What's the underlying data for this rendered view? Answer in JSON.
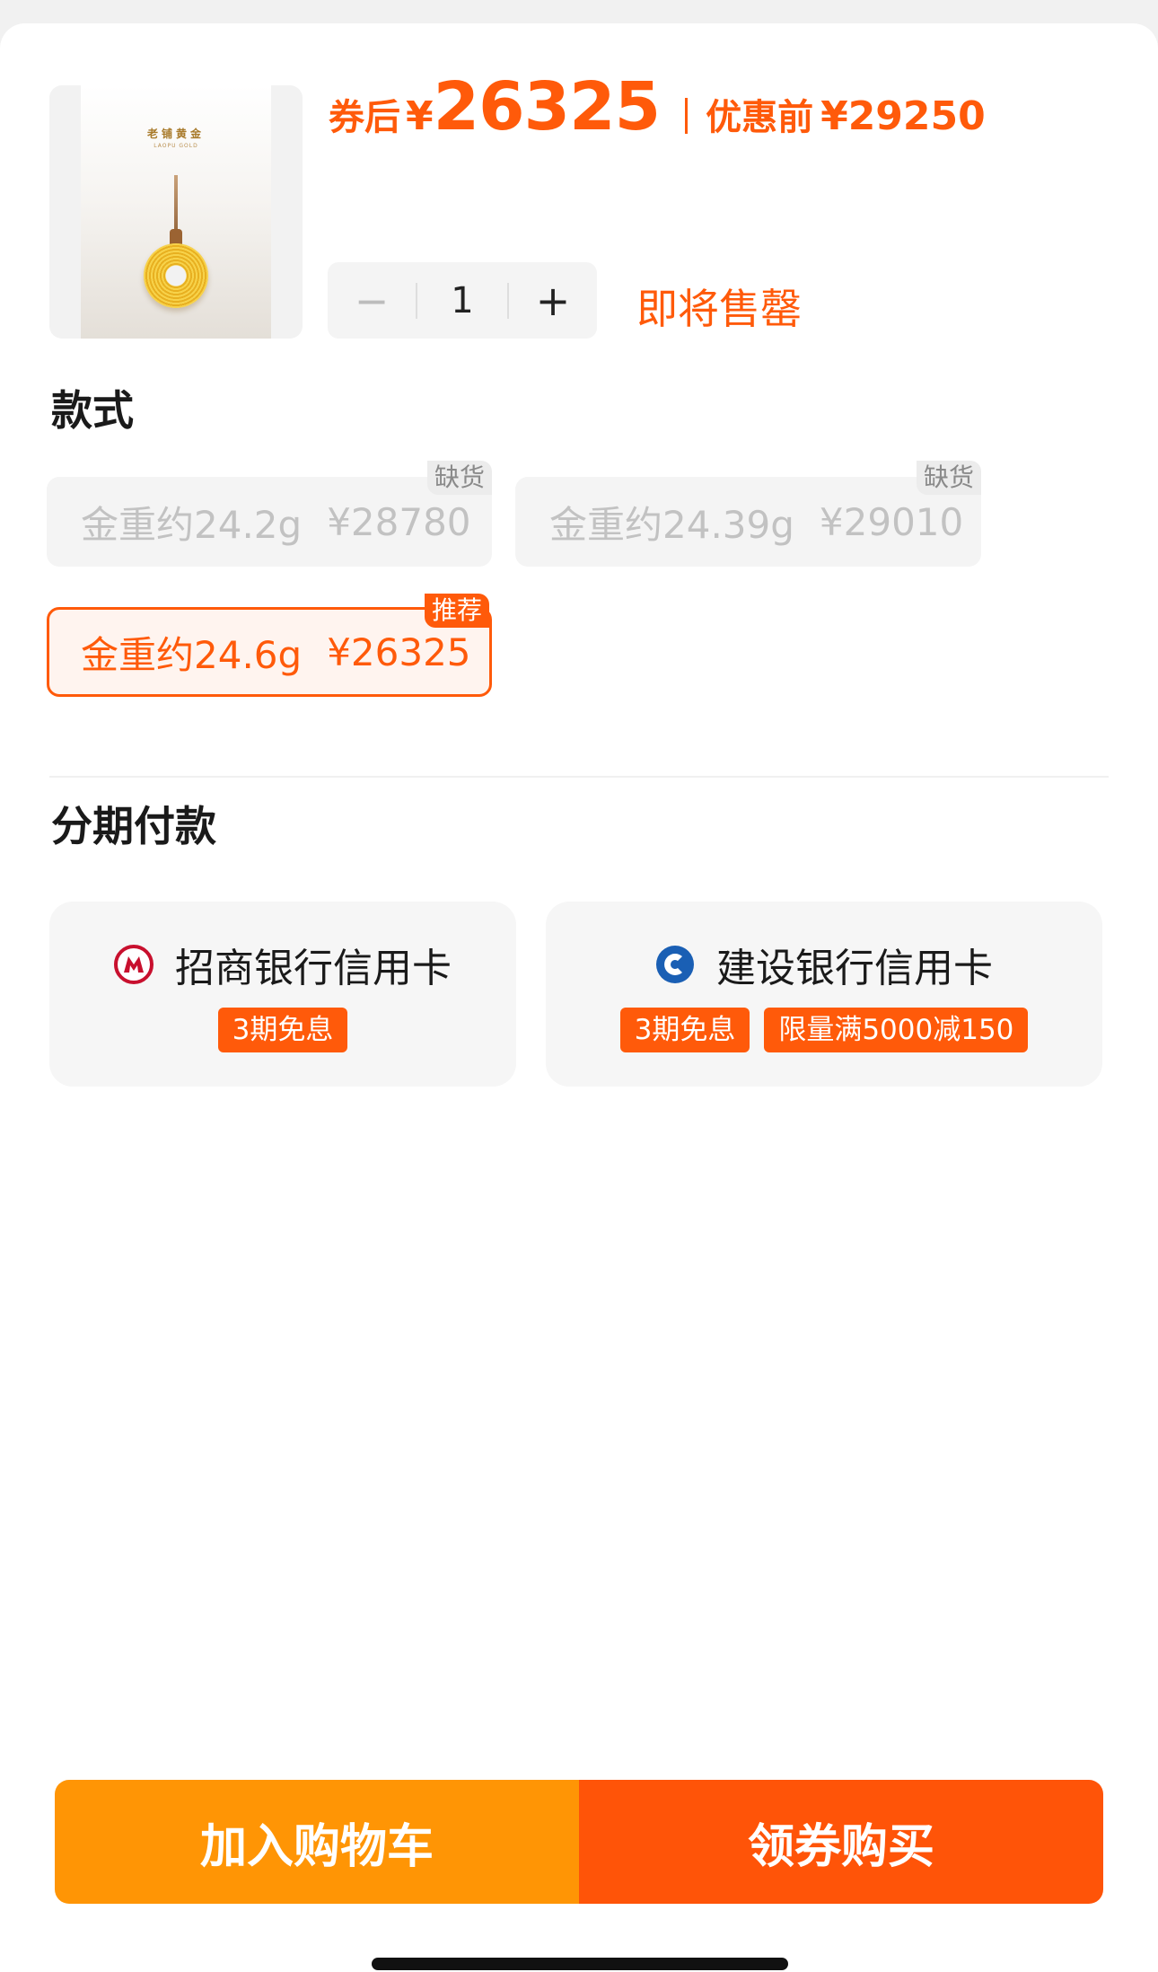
{
  "product": {
    "thumb_brand_cn": "老铺黄金",
    "thumb_brand_en": "LAOPU GOLD",
    "after_coupon_label": "券后",
    "currency": "¥",
    "after_coupon_price": "26325",
    "before_label": "优惠前",
    "before_price": "¥29250"
  },
  "quantity": {
    "minus": "−",
    "value": "1",
    "plus": "+"
  },
  "stock_note": "即将售罄",
  "styles": {
    "title": "款式",
    "options": [
      {
        "weight": "金重约24.2g",
        "price": "¥28780",
        "tag": "缺货",
        "state": "disabled"
      },
      {
        "weight": "金重约24.39g",
        "price": "¥29010",
        "tag": "缺货",
        "state": "disabled"
      },
      {
        "weight": "金重约24.6g",
        "price": "¥26325",
        "tag": "推荐",
        "state": "selected"
      }
    ]
  },
  "installment": {
    "title": "分期付款",
    "banks": [
      {
        "name": "招商银行信用卡",
        "icon": "cmb-logo-icon",
        "tags": [
          "3期免息"
        ]
      },
      {
        "name": "建设银行信用卡",
        "icon": "ccb-logo-icon",
        "tags": [
          "3期免息",
          "限量满5000减150"
        ]
      }
    ]
  },
  "actions": {
    "add_to_cart": "加入购物车",
    "buy_with_coupon": "领券购买"
  },
  "colors": {
    "accent": "#ff5a0a",
    "cart_button": "#ff9505",
    "buy_button": "#ff5408"
  }
}
